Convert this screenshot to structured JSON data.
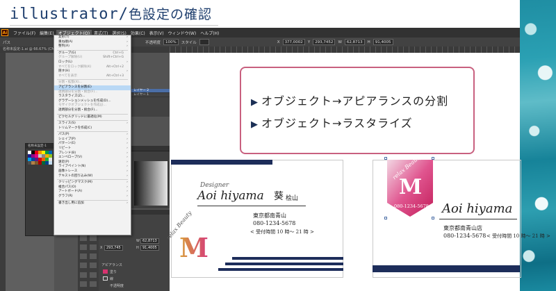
{
  "header": {
    "title_en": "illustrator",
    "title_sep": "/",
    "title_jp": "色設定の確認"
  },
  "menubar": {
    "logo": "Ai",
    "items": [
      "ファイル(F)",
      "編集(E)",
      "オブジェクト(O)",
      "書式(T)",
      "選択(S)",
      "効果(C)",
      "表示(V)",
      "ウィンドウ(W)",
      "ヘルプ(H)"
    ],
    "active_index": 2
  },
  "controlbar": {
    "path_label": "パス",
    "style_label": "不透明度",
    "opacity": "100%",
    "style": "スタイル",
    "x_label": "X",
    "x_value": "377,0002",
    "y_label": "Y",
    "y_value": "293,7452",
    "w_label": "W",
    "w_value": "62,8713",
    "h_label": "H",
    "h_value": "91,4005"
  },
  "docbar": {
    "tab": "名称未設定-1.ai @ 66.67% (CMYK/プレビュー)"
  },
  "object_menu": {
    "items": [
      {
        "label": "変形(T)",
        "submenu": true
      },
      {
        "label": "重ね順(A)",
        "submenu": true
      },
      {
        "label": "整列(A)",
        "submenu": true
      },
      {
        "sep": true
      },
      {
        "label": "グループ(G)",
        "shortcut": "Ctrl+G"
      },
      {
        "label": "グループ解除(U)",
        "shortcut": "Shift+Ctrl+G",
        "disabled": true
      },
      {
        "label": "ロック(L)",
        "submenu": true
      },
      {
        "label": "すべてをロック解除(K)",
        "shortcut": "Alt+Ctrl+2",
        "disabled": true
      },
      {
        "label": "隠す(H)",
        "submenu": true
      },
      {
        "label": "すべてを表示",
        "shortcut": "Alt+Ctrl+3",
        "disabled": true
      },
      {
        "sep": true
      },
      {
        "label": "分割・拡張(X)...",
        "disabled": true
      },
      {
        "label": "アピアランスを分割(E)",
        "highlight": true
      },
      {
        "label": "透明部分を分割・統合(F)...",
        "disabled": true
      },
      {
        "label": "ラスタライズ(Z)..."
      },
      {
        "label": "グラデーションメッシュを作成(D)..."
      },
      {
        "label": "モザイクオブジェクトを作成(J)...",
        "disabled": true
      },
      {
        "label": "透明部分を分割・統合(F)..."
      },
      {
        "sep": true
      },
      {
        "label": "ピクセルグリッドに最適化(M)"
      },
      {
        "sep": true
      },
      {
        "label": "スライス(S)",
        "submenu": true
      },
      {
        "label": "トリムマークを作成(C)"
      },
      {
        "sep": true
      },
      {
        "label": "パス(P)",
        "submenu": true
      },
      {
        "label": "シェイプ(P)",
        "submenu": true
      },
      {
        "label": "パターン(E)",
        "submenu": true
      },
      {
        "label": "リピート",
        "submenu": true
      },
      {
        "label": "ブレンド(B)",
        "submenu": true
      },
      {
        "label": "エンベロープ(V)",
        "submenu": true
      },
      {
        "label": "遠近(P)",
        "submenu": true
      },
      {
        "label": "ライブペイント(N)",
        "submenu": true
      },
      {
        "label": "画像トレース",
        "submenu": true
      },
      {
        "label": "テキストの回り込み(W)",
        "submenu": true
      },
      {
        "sep": true
      },
      {
        "label": "クリッピングマスク(M)",
        "submenu": true
      },
      {
        "label": "複合パス(O)",
        "submenu": true
      },
      {
        "label": "アートボード(A)",
        "submenu": true
      },
      {
        "label": "グラフ(R)",
        "submenu": true
      },
      {
        "sep": true
      },
      {
        "label": "書き出し用に追加",
        "submenu": true
      }
    ]
  },
  "layers_panel": {
    "rows": [
      "レイヤー 2",
      "レイヤー 1"
    ],
    "selected_index": 0
  },
  "swatch_panel": {
    "title": "名称未設定-1",
    "colors": [
      "#ffffff",
      "#000000",
      "#e60012",
      "#f39800",
      "#fff100",
      "#009944",
      "#0068b7",
      "#1d2088",
      "#920783",
      "#e4007f",
      "#c8c8c8",
      "#888888",
      "#f6ab00",
      "#8fc31f",
      "#00a0e9",
      "#00479d",
      "#601986",
      "#d7000f",
      "#eb6100",
      "#22ac38",
      "#e5e5e5",
      "#4d4d4d",
      "#b28146",
      "#7d5a2c",
      "#a40000",
      "#006934",
      "#003f8e",
      "#c2dbee"
    ]
  },
  "properties": {
    "w_label": "W",
    "w_value": "62,8713",
    "x_label": "X",
    "x_value": "293,745",
    "h_label": "H",
    "h_value": "91,4005",
    "appearance_label": "アピアランス",
    "fill_label": "塗り",
    "stroke_label": "線",
    "opacity_label": "不透明度"
  },
  "callout": {
    "line1": "オブジェクト→アピアランスの分割",
    "line2": "オブジェクト→ラスタライズ"
  },
  "card_left": {
    "designer": "Designer",
    "name_script": "Aoi hiyama",
    "name_kanji": "葵",
    "name_kana": "桧山",
    "address": "東京都南青山",
    "phone": "080-1234-5678",
    "hours": "< 受付時間 10 時〜 21 時 >",
    "badge_text": "relax Beauty",
    "badge_letter": "M"
  },
  "card_right": {
    "badge_text": "relax Beauty",
    "badge_letter": "M",
    "badge_phone": "080-1234-5678",
    "name_script": "Aoi hiyama",
    "address": "東京都南青山店",
    "phone": "080-1234-5678",
    "hours": "< 受付時間 10 時〜 21 時 >"
  },
  "colors": {
    "accent_pink": "#c8607f",
    "navy": "#1d2d5a",
    "title_blue": "#1f3f6e"
  }
}
